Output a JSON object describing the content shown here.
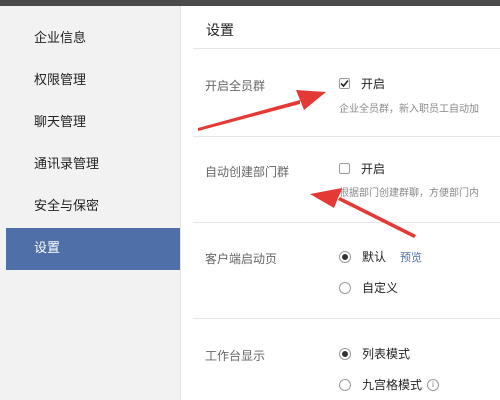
{
  "sidebar": {
    "items": [
      {
        "label": "企业信息"
      },
      {
        "label": "权限管理"
      },
      {
        "label": "聊天管理"
      },
      {
        "label": "通讯录管理"
      },
      {
        "label": "安全与保密"
      },
      {
        "label": "设置"
      }
    ],
    "active_index": 5
  },
  "main": {
    "title": "设置",
    "all_staff_group": {
      "label": "开启全员群",
      "option": "开启",
      "checked": true,
      "description": "企业全员群，新入职员工自动加"
    },
    "dept_group": {
      "label": "自动创建部门群",
      "option": "开启",
      "checked": false,
      "description": "根据部门创建群聊，方便部门内"
    },
    "client_startup": {
      "label": "客户端启动页",
      "options": [
        "默认",
        "自定义"
      ],
      "selected": "默认",
      "preview_link": "预览"
    },
    "workbench_display": {
      "label": "工作台显示",
      "options": [
        "列表模式",
        "九宫格模式"
      ],
      "selected": "列表模式",
      "info_glyph": "i"
    }
  },
  "colors": {
    "sidebar_bg": "#f2f2f2",
    "active_bg": "#4e6fa7",
    "arrow": "#e53935",
    "link": "#4e6fa7"
  }
}
